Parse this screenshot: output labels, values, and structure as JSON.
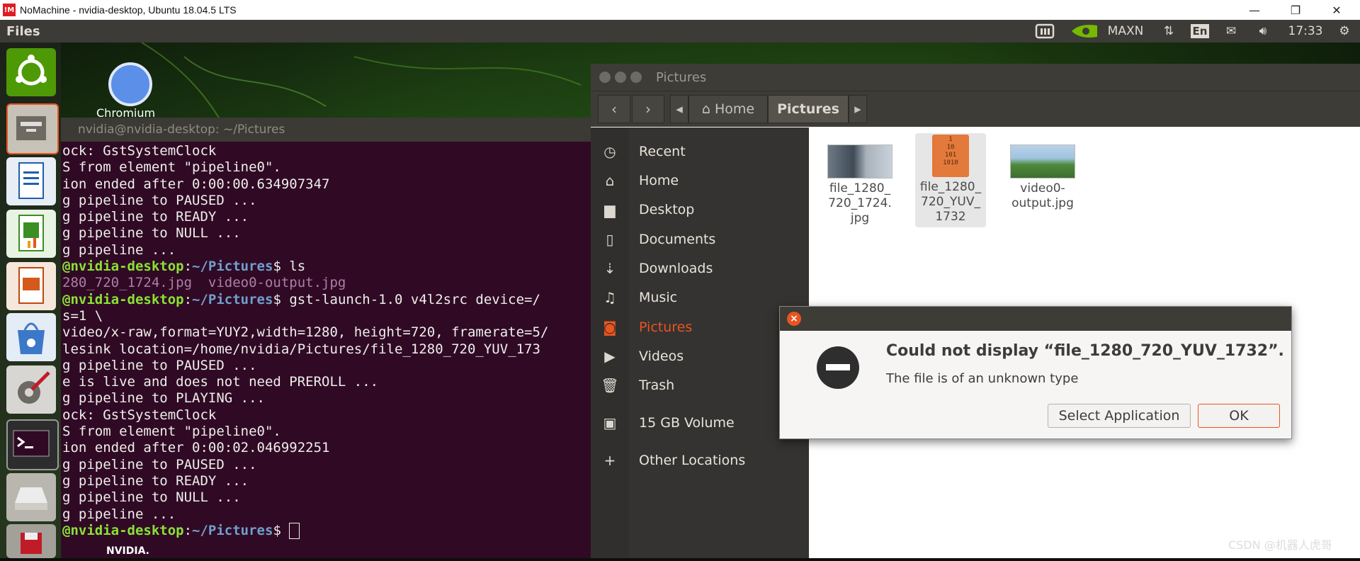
{
  "host_window": {
    "title": "NoMachine - nvidia-desktop, Ubuntu 18.04.5 LTS",
    "minimize": "—",
    "restore": "❐",
    "close": "✕"
  },
  "top_panel": {
    "app_name": "Files",
    "power_mode": "MAXN",
    "keyboard": "En",
    "clock": "17:33"
  },
  "desktop": {
    "chromium_label": "Chromium",
    "nvidia_label": "NVIDIA."
  },
  "terminal": {
    "title": "nvidia@nvidia-desktop: ~/Pictures",
    "lines": [
      "ock: GstSystemClock",
      "S from element \"pipeline0\".",
      "ion ended after 0:00:00.634907347",
      "g pipeline to PAUSED ...",
      "g pipeline to READY ...",
      "g pipeline to NULL ...",
      "g pipeline ..."
    ],
    "prompt_user": "@nvidia-desktop",
    "prompt_path": "~/Pictures",
    "cmd_ls": "$ ls",
    "ls_output": "280_720_1724.jpg  video0-output.jpg",
    "cmd_gst": "$ gst-launch-1.0 v4l2src device=/",
    "lines2": [
      "s=1 \\",
      "video/x-raw,format=YUY2,width=1280, height=720, framerate=5/",
      "lesink location=/home/nvidia/Pictures/file_1280_720_YUV_173",
      "g pipeline to PAUSED ...",
      "e is live and does not need PREROLL ...",
      "g pipeline to PLAYING ...",
      "ock: GstSystemClock",
      "S from element \"pipeline0\".",
      "ion ended after 0:00:02.046992251",
      "g pipeline to PAUSED ...",
      "g pipeline to READY ...",
      "g pipeline to NULL ...",
      "g pipeline ..."
    ],
    "prompt_end": "$ "
  },
  "file_manager": {
    "title": "Pictures",
    "back": "‹",
    "forward": "›",
    "crumb_left": "◂",
    "crumb_home": "Home",
    "crumb_current": "Pictures",
    "crumb_right": "▸",
    "sidebar": [
      {
        "label": "Recent",
        "icon": "clock-icon"
      },
      {
        "label": "Home",
        "icon": "home-icon"
      },
      {
        "label": "Desktop",
        "icon": "folder-icon"
      },
      {
        "label": "Documents",
        "icon": "document-icon"
      },
      {
        "label": "Downloads",
        "icon": "download-icon"
      },
      {
        "label": "Music",
        "icon": "music-icon"
      },
      {
        "label": "Pictures",
        "icon": "camera-icon"
      },
      {
        "label": "Videos",
        "icon": "video-icon"
      },
      {
        "label": "Trash",
        "icon": "trash-icon"
      },
      {
        "label": "15 GB Volume",
        "icon": "drive-icon"
      },
      {
        "label": "Other Locations",
        "icon": "plus-icon"
      }
    ],
    "files": [
      {
        "name_l1": "file_1280_",
        "name_l2": "720_1724.",
        "name_l3": "jpg"
      },
      {
        "name_l1": "file_1280_",
        "name_l2": "720_YUV_",
        "name_l3": "1732"
      },
      {
        "name_l1": "video0-",
        "name_l2": "output.jpg",
        "name_l3": ""
      }
    ],
    "binary_icon_text": "1\n10\n101\n1010"
  },
  "dialog": {
    "close": "×",
    "title": "Could not display “file_1280_720_YUV_1732”.",
    "message": "The file is of an unknown type",
    "select_app": "Select Application",
    "ok": "OK"
  },
  "watermark": "CSDN @机器人虎哥",
  "colors": {
    "accent": "#e95420",
    "terminal_bg": "#300a24",
    "prompt_green": "#8ae234",
    "prompt_blue": "#729fcf"
  }
}
